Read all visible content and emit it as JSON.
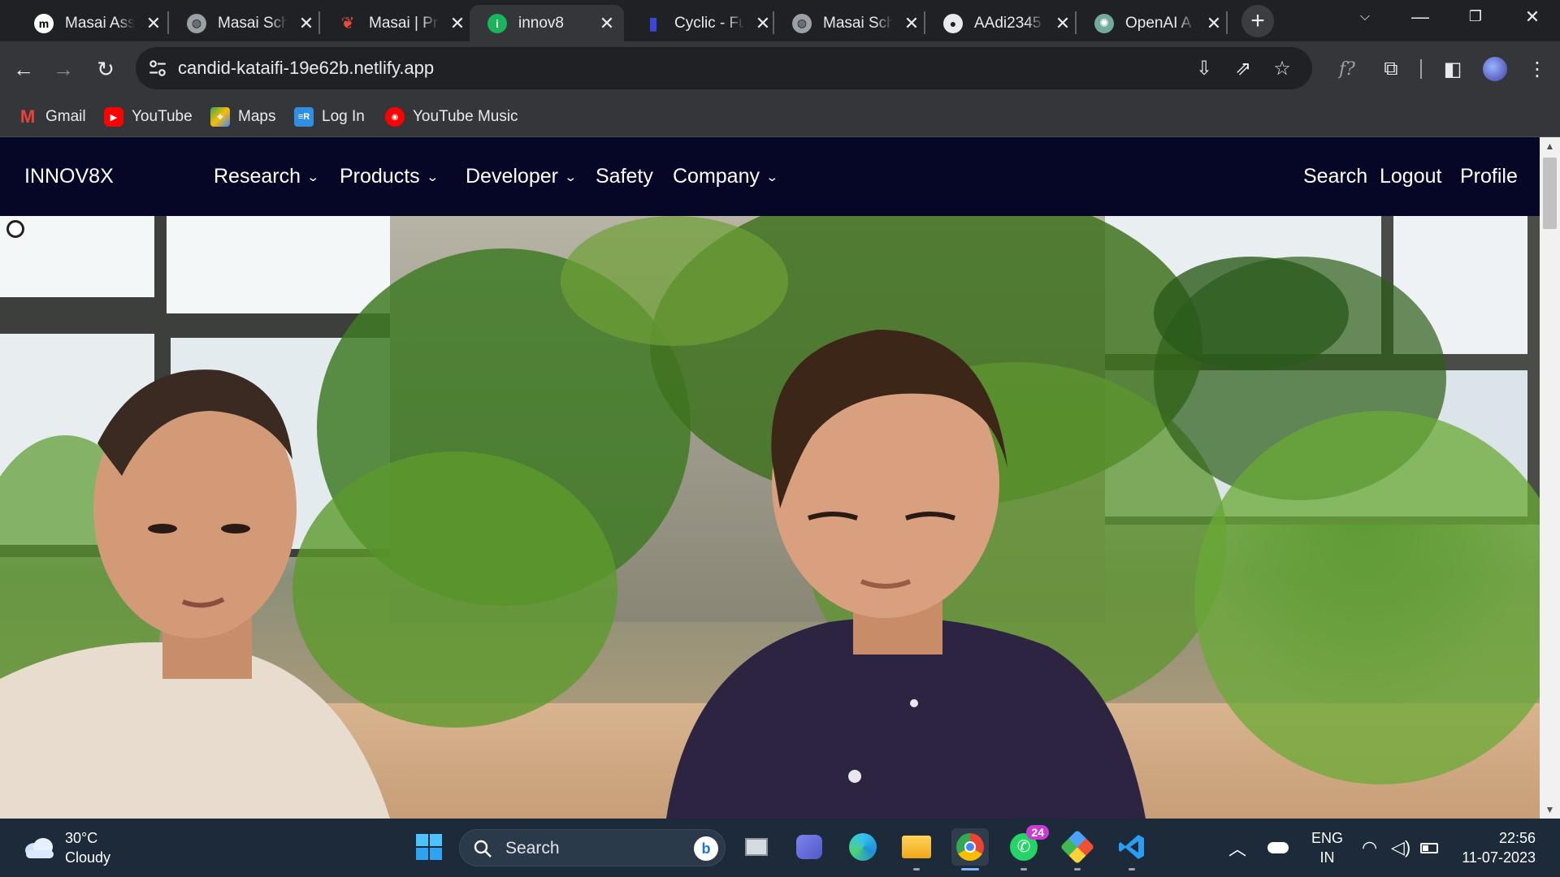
{
  "browser": {
    "tabs": [
      {
        "title": "Masai Ass",
        "favicon": "masai-m-icon",
        "active": false
      },
      {
        "title": "Masai Sch",
        "favicon": "globe-icon",
        "active": false
      },
      {
        "title": "Masai | Pr",
        "favicon": "masai-flame-icon",
        "active": false
      },
      {
        "title": "innov8",
        "favicon": "innov8-icon",
        "active": true
      },
      {
        "title": "Cyclic - Fu",
        "favicon": "cyclic-icon",
        "active": false
      },
      {
        "title": "Masai Sch",
        "favicon": "globe-icon",
        "active": false
      },
      {
        "title": "AAdi2345",
        "favicon": "github-icon",
        "active": false
      },
      {
        "title": "OpenAI A",
        "favicon": "openai-icon",
        "active": false
      }
    ],
    "address": "candid-kataifi-19e62b.netlify.app",
    "bookmarks": [
      {
        "label": "Gmail",
        "icon": "gmail-icon"
      },
      {
        "label": "YouTube",
        "icon": "youtube-icon"
      },
      {
        "label": "Maps",
        "icon": "maps-icon"
      },
      {
        "label": "Log In",
        "icon": "login-icon"
      },
      {
        "label": "YouTube Music",
        "icon": "youtube-music-icon"
      }
    ]
  },
  "site": {
    "brand": "INNOV8X",
    "nav": [
      {
        "label": "Research",
        "dropdown": true
      },
      {
        "label": "Products",
        "dropdown": true
      },
      {
        "label": "Developer",
        "dropdown": true
      },
      {
        "label": "Safety",
        "dropdown": false
      },
      {
        "label": "Company",
        "dropdown": true
      }
    ],
    "right_links": [
      "Search",
      "Logout",
      "Profile"
    ],
    "nav_bg": "#060626"
  },
  "taskbar": {
    "weather_temp": "30°C",
    "weather_desc": "Cloudy",
    "search_label": "Search",
    "whatsapp_badge": "24",
    "lang_top": "ENG",
    "lang_bottom": "IN",
    "time": "22:56",
    "date": "11-07-2023",
    "apps": [
      "windows-start-icon",
      "search-icon",
      "bing-icon",
      "task-view-icon",
      "teams-icon",
      "edge-icon",
      "file-explorer-icon",
      "chrome-icon",
      "whatsapp-icon",
      "git-icon",
      "vscode-icon"
    ]
  }
}
